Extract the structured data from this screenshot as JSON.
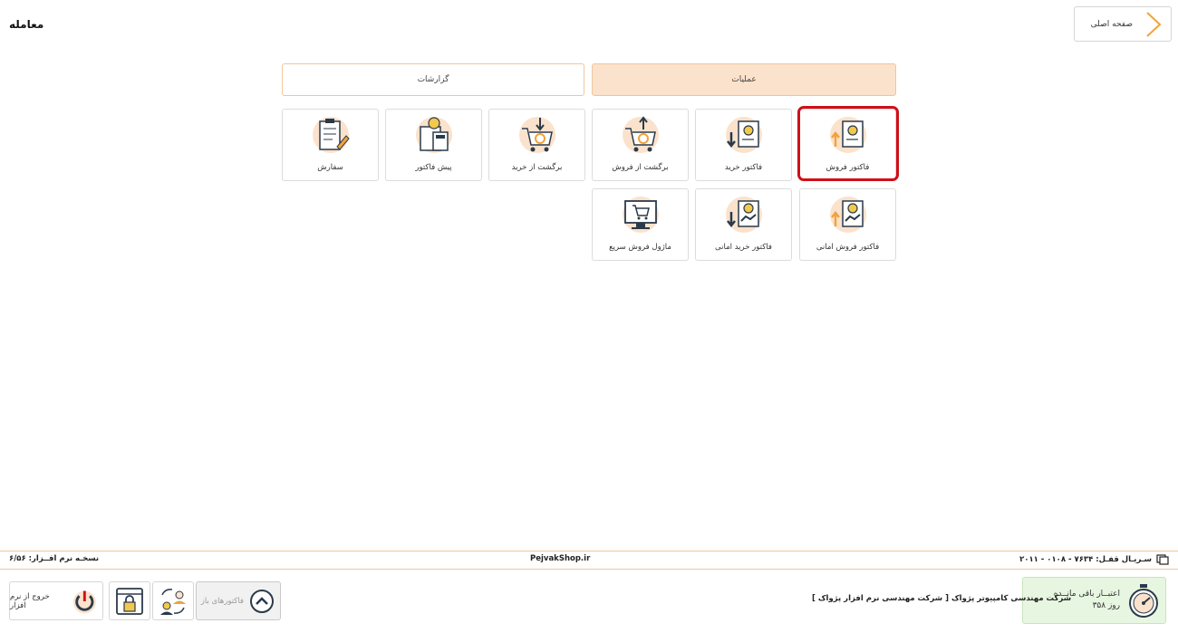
{
  "header": {
    "page_title": "معامله",
    "home_label": "صفحه اصلی"
  },
  "tabs": [
    {
      "label": "گزارشات",
      "active": false
    },
    {
      "label": "عملیات",
      "active": true
    }
  ],
  "tiles": {
    "sales_invoice": "فاکتور فروش",
    "purchase_invoice": "فاکتور خرید",
    "sales_return": "برگشت از فروش",
    "purchase_return": "برگشت از خرید",
    "proforma_invoice": "پیش فاکتور",
    "order": "سفارش",
    "consignment_sales_invoice": "فاکتور فروش امانی",
    "consignment_purchase_invoice": "فاکتور خرید امانی",
    "quick_sales_module": "ماژول فروش سریع"
  },
  "icons": {
    "home": "chevron-right-icon",
    "tile_color": "#fbe2cc",
    "accent": "#f2a23a",
    "highlight": "#d10f17"
  },
  "footer": {
    "serial": "سـریـال قفـل:  ۷۶۳۴ - ۰۱۰۸ - ۲۰۱۱",
    "site": "PejvakShop.ir",
    "version": "نسخـه نرم افــزار: ۶/۵۶",
    "credit_title": "اعتبــار باقی مانــده",
    "credit_value": "۳۵۸ روز",
    "company": "شرکت مهندسی کامپیوتر پژواک [ شرکت مهندسی نرم افزار پژواک ]",
    "open_invoices": "فاکتورهای باز",
    "exit": "خروج از نرم افزار"
  }
}
